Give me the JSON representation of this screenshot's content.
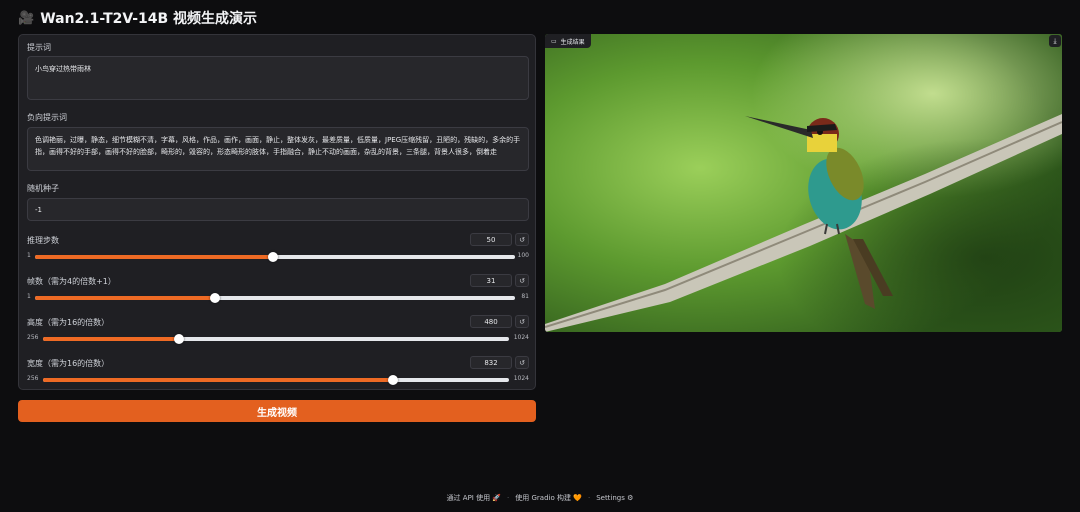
{
  "app": {
    "title_emoji": "🎥",
    "title": "Wan2.1-T2V-14B 视频生成演示"
  },
  "prompt": {
    "label": "提示词",
    "value": "小鸟穿过热带雨林"
  },
  "negative_prompt": {
    "label": "负向提示词",
    "value": "色调艳丽，过曝，静态，细节模糊不清，字幕，风格，作品，画作，画面，静止，整体发灰，最差质量，低质量，JPEG压缩残留，丑陋的，残缺的，多余的手指，画得不好的手部，画得不好的脸部，畸形的，毁容的，形态畸形的肢体，手指融合，静止不动的画面，杂乱的背景，三条腿，背景人很多，倒着走"
  },
  "seed": {
    "label": "随机种子",
    "value": "-1"
  },
  "sliders": [
    {
      "label": "推理步数",
      "value": "50",
      "min": "1",
      "max": "100",
      "fraction": 0.495
    },
    {
      "label": "帧数（需为4的倍数+1）",
      "value": "31",
      "min": "1",
      "max": "81",
      "fraction": 0.375
    },
    {
      "label": "高度（需为16的倍数）",
      "value": "480",
      "min": "256",
      "max": "1024",
      "fraction": 0.292
    },
    {
      "label": "宽度（需为16的倍数）",
      "value": "832",
      "min": "256",
      "max": "1024",
      "fraction": 0.75
    }
  ],
  "reset_icon": "↺",
  "generate_button": "生成视频",
  "output": {
    "label": "生成结果",
    "badge_icon": "video-camera-icon",
    "download_icon": "download-icon"
  },
  "footer": {
    "api_link": "通过 API 使用",
    "api_emoji": "🚀",
    "separator": "·",
    "gradio_link": "使用 Gradio 构建",
    "gradio_emoji": "🧡",
    "settings_link": "Settings",
    "settings_emoji": "⚙"
  },
  "colors": {
    "accent": "#e3601f",
    "background": "#0d0d0f",
    "panel": "#1f1f23"
  }
}
